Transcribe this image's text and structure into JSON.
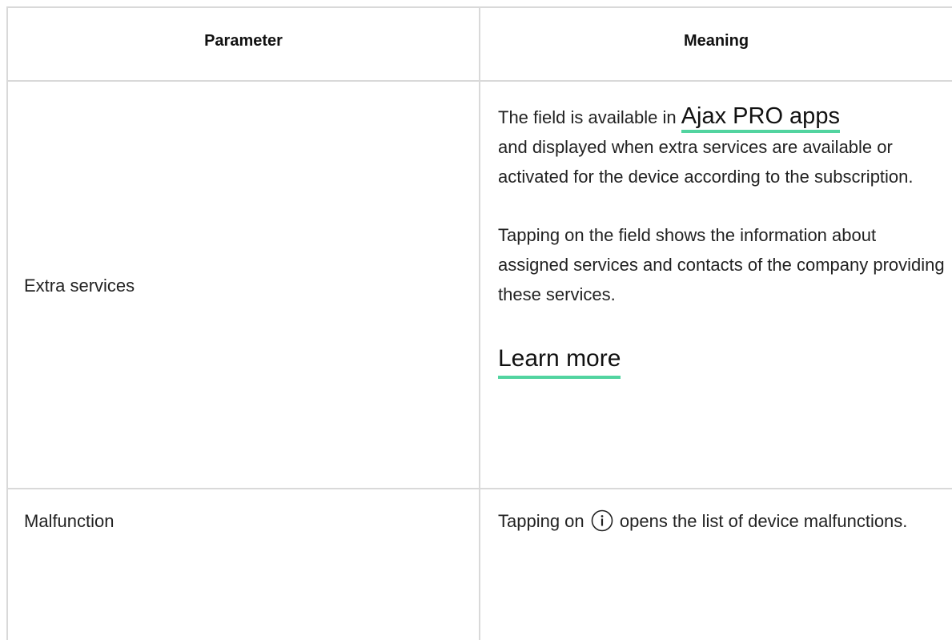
{
  "table": {
    "headers": {
      "parameter": "Parameter",
      "meaning": "Meaning"
    },
    "rows": [
      {
        "parameter": "Extra services",
        "meaning": {
          "p1_before_link": "The field is available in ",
          "p1_link": "Ajax PRO apps",
          "p1_after_link": "and displayed when extra services are available or activated for the device according to the subscription.",
          "p2": "Tapping on the field shows the information about assigned services and contacts of the company providing these services.",
          "learn_more_link": "Learn more"
        }
      },
      {
        "parameter": "Malfunction",
        "meaning": {
          "before_icon": "Tapping on ",
          "icon": "info-icon",
          "after_icon": " opens the list of device malfunctions."
        }
      }
    ]
  },
  "colors": {
    "border": "#d9d9d9",
    "link_underline": "#52d4a0",
    "text": "#222222"
  }
}
